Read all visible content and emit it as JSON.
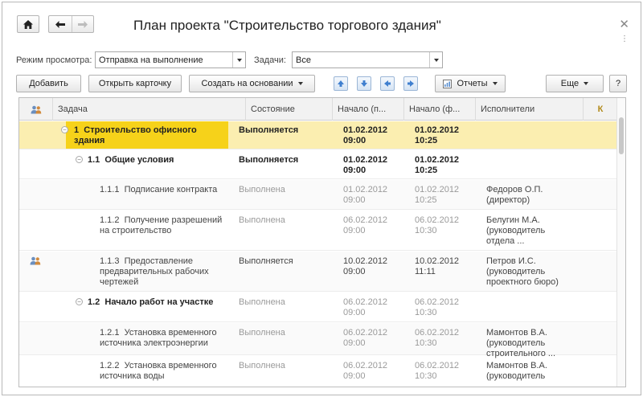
{
  "window": {
    "title": "План проекта \"Строительство торгового здания\""
  },
  "filters": {
    "view_mode_label": "Режим просмотра:",
    "view_mode_value": "Отправка на выполнение",
    "tasks_label": "Задачи:",
    "tasks_value": "Все"
  },
  "toolbar": {
    "add": "Добавить",
    "open_card": "Открыть карточку",
    "create_based": "Создать на основании",
    "reports": "Отчеты",
    "more": "Еще",
    "help": "?"
  },
  "columns": {
    "task": "Задача",
    "state": "Состояние",
    "start": "Начало (п...",
    "start_fact": "Начало (ф...",
    "executors": "Исполнители",
    "k": "К"
  },
  "rows": [
    {
      "num": "1",
      "name_l1": "Строительство офисного",
      "name_l2": "здания",
      "state": "Выполняется",
      "start_date": "01.02.2012",
      "start_time": "09:00",
      "fact_date": "01.02.2012",
      "fact_time": "10:25",
      "exec_l1": "",
      "exec_l2": "",
      "exec_l3": ""
    },
    {
      "num": "1.1",
      "name_l1": "Общие условия",
      "name_l2": "",
      "state": "Выполняется",
      "start_date": "01.02.2012",
      "start_time": "09:00",
      "fact_date": "01.02.2012",
      "fact_time": "10:25",
      "exec_l1": "",
      "exec_l2": "",
      "exec_l3": ""
    },
    {
      "num": "1.1.1",
      "name_l1": "Подписание контракта",
      "name_l2": "",
      "state": "Выполнена",
      "start_date": "01.02.2012",
      "start_time": "09:00",
      "fact_date": "01.02.2012",
      "fact_time": "10:25",
      "exec_l1": "Федоров О.П.",
      "exec_l2": "(директор)",
      "exec_l3": ""
    },
    {
      "num": "1.1.2",
      "name_l1": "Получение разрешений",
      "name_l2": "на строительство",
      "state": "Выполнена",
      "start_date": "06.02.2012",
      "start_time": "09:00",
      "fact_date": "06.02.2012",
      "fact_time": "10:30",
      "exec_l1": "Белугин М.А.",
      "exec_l2": "(руководитель",
      "exec_l3": "отдела ..."
    },
    {
      "num": "1.1.3",
      "name_l1": "Предоставление",
      "name_l2": "предварительных рабочих",
      "name_l3": "чертежей",
      "state": "Выполняется",
      "start_date": "10.02.2012",
      "start_time": "09:00",
      "fact_date": "10.02.2012",
      "fact_time": "11:11",
      "exec_l1": "Петров И.С.",
      "exec_l2": "(руководитель",
      "exec_l3": "проектного бюро)"
    },
    {
      "num": "1.2",
      "name_l1": "Начало работ на участке",
      "name_l2": "",
      "state": "Выполнена",
      "start_date": "06.02.2012",
      "start_time": "09:00",
      "fact_date": "06.02.2012",
      "fact_time": "10:30",
      "exec_l1": "",
      "exec_l2": "",
      "exec_l3": ""
    },
    {
      "num": "1.2.1",
      "name_l1": "Установка временного",
      "name_l2": "источника электроэнергии",
      "state": "Выполнена",
      "start_date": "06.02.2012",
      "start_time": "09:00",
      "fact_date": "06.02.2012",
      "fact_time": "10:30",
      "exec_l1": "Мамонтов В.А.",
      "exec_l2": "(руководитель",
      "exec_l3": "строительного ..."
    },
    {
      "num": "1.2.2",
      "name_l1": "Установка временного",
      "name_l2": "источника воды",
      "state": "Выполнена",
      "start_date": "06.02.2012",
      "start_time": "09:00",
      "fact_date": "06.02.2012",
      "fact_time": "10:30",
      "exec_l1": "Мамонтов В.А.",
      "exec_l2": "(руководитель",
      "exec_l3": ""
    }
  ],
  "colors": {
    "selected_row": "#fbeeb0",
    "selected_cell": "#f6d21a",
    "arrow_blue": "#3f7fcf"
  },
  "icons": [
    "home-icon",
    "back-arrow-icon",
    "forward-arrow-icon",
    "close-icon",
    "users-icon",
    "report-icon"
  ]
}
